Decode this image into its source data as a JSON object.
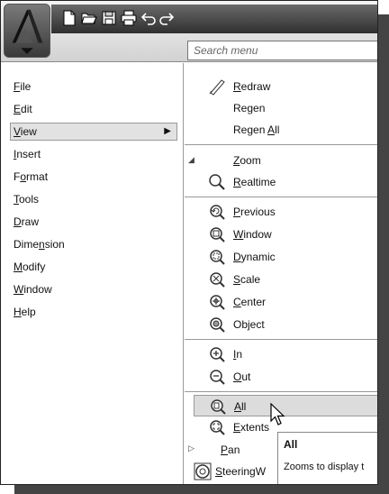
{
  "search": {
    "placeholder": "Search menu"
  },
  "left_menu": [
    {
      "label": "File",
      "selected": false
    },
    {
      "label": "Edit",
      "selected": false
    },
    {
      "label": "View",
      "selected": true
    },
    {
      "label": "Insert",
      "selected": false
    },
    {
      "label": "Format",
      "selected": false
    },
    {
      "label": "Tools",
      "selected": false
    },
    {
      "label": "Draw",
      "selected": false
    },
    {
      "label": "Dimension",
      "selected": false
    },
    {
      "label": "Modify",
      "selected": false
    },
    {
      "label": "Window",
      "selected": false
    },
    {
      "label": "Help",
      "selected": false
    }
  ],
  "view_submenu": {
    "redraw": "Redraw",
    "regen": "Regen",
    "regen_all": "Regen All",
    "zoom": "Zoom",
    "realtime": "Realtime",
    "previous": "Previous",
    "window": "Window",
    "dynamic": "Dynamic",
    "scale": "Scale",
    "center": "Center",
    "object": "Object",
    "in": "In",
    "out": "Out",
    "all": "All",
    "extents": "Extents",
    "pan": "Pan",
    "steeringwheels": "SteeringW"
  },
  "tooltip": {
    "title": "All",
    "description": "Zooms to display t"
  }
}
